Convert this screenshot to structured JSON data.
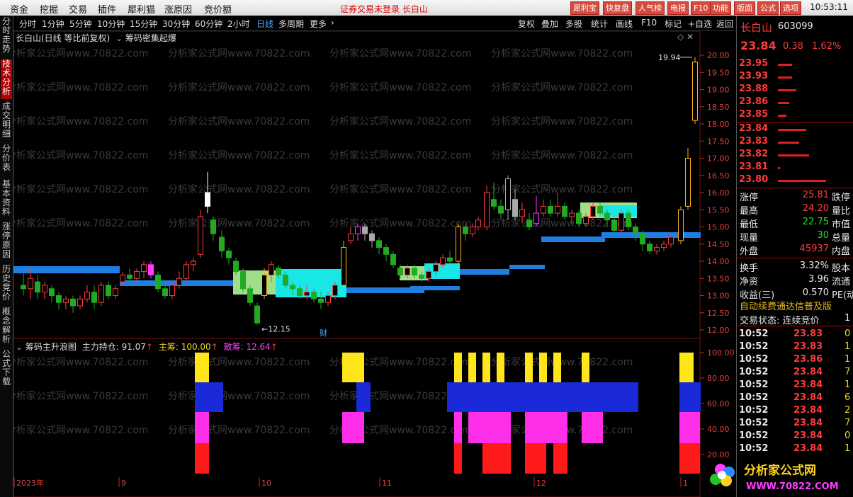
{
  "menu": [
    "资金",
    "挖掘",
    "交易",
    "插件",
    "犀利猫",
    "涨原因",
    "竞价额"
  ],
  "notice": "证券交易未登录  长白山",
  "top_buttons": [
    "犀利宝",
    "快复盘",
    "人气榜",
    "电报",
    "F10",
    "功能",
    "版面",
    "公式",
    "选项"
  ],
  "clock": "10:53:11",
  "left_tabs": [
    "分时走势",
    "技术分析",
    "成交明细",
    "分价表",
    "基本资料",
    "涨停原因",
    "历史竞价",
    "概念解析",
    "公式下载"
  ],
  "periods": [
    "分时",
    "1分钟",
    "5分钟",
    "10分钟",
    "15分钟",
    "30分钟",
    "60分钟",
    "2小时",
    "日线",
    "多周期",
    "更多"
  ],
  "active_period": "日线",
  "tools": [
    "复权",
    "叠加",
    "多股",
    "统计",
    "画线",
    "F10",
    "标记",
    "+自选",
    "返回"
  ],
  "chart_title": "长白山(日线 等比前复权)",
  "chart_indicator": "筹码密集起爆",
  "ind_title": "筹码主升浪图",
  "ind_vals": {
    "l1": "主力持仓: 91.07",
    "l2": "主筹: 100.00",
    "l3": "散筹: 12.64"
  },
  "annotations": {
    "high": "19.94",
    "low": "12.15",
    "cai": "财"
  },
  "axis_labels": [
    "20.00",
    "19.50",
    "19.00",
    "18.50",
    "18.00",
    "17.50",
    "17.00",
    "16.50",
    "16.00",
    "15.50",
    "15.00",
    "14.50",
    "14.00",
    "13.50",
    "13.00",
    "12.50",
    "12.00"
  ],
  "ind_axis": [
    "100.00",
    "80.00",
    "60.00",
    "40.00",
    "20.00"
  ],
  "x_labels": [
    "2023年",
    "9",
    "10",
    "11",
    "12",
    "1"
  ],
  "watermark": "分析家公式网www.70822.com",
  "stock": {
    "name": "长白山",
    "code": "603099",
    "price": "23.84",
    "change": "0.38",
    "pct": "1.62%"
  },
  "asks": [
    {
      "p": "23.95",
      "w": 20
    },
    {
      "p": "23.93",
      "w": 20
    },
    {
      "p": "23.88",
      "w": 26
    },
    {
      "p": "23.86",
      "w": 16
    },
    {
      "p": "23.85",
      "w": 12
    }
  ],
  "bids": [
    {
      "p": "23.84",
      "w": 40
    },
    {
      "p": "23.83",
      "w": 30
    },
    {
      "p": "23.82",
      "w": 44
    },
    {
      "p": "23.81",
      "w": 3
    },
    {
      "p": "23.80",
      "w": 68
    }
  ],
  "quote_rows": [
    {
      "l": "涨停",
      "v": "25.81",
      "vc": "red",
      "r": "跌停"
    },
    {
      "l": "最高",
      "v": "24.20",
      "vc": "red",
      "r": "量比"
    },
    {
      "l": "最低",
      "v": "22.75",
      "vc": "green",
      "r": "市值"
    },
    {
      "l": "现量",
      "v": "30",
      "vc": "green",
      "r": "总量"
    },
    {
      "l": "外盘",
      "v": "45937",
      "vc": "red",
      "r": "内盘"
    }
  ],
  "quote_rows2": [
    {
      "l": "换手",
      "v": "3.32%",
      "r": "股本"
    },
    {
      "l": "净资",
      "v": "3.96",
      "r": "流通"
    },
    {
      "l": "收益(三)",
      "v": "0.570",
      "r": "PE(动"
    }
  ],
  "scroll_text": "自动续费通达信普及版",
  "trade_status": "交易状态: 连续竞价",
  "trade_status_num": "1",
  "ticks": [
    {
      "t": "10:52",
      "p": "23.83",
      "c": "red",
      "v": "0"
    },
    {
      "t": "10:52",
      "p": "23.83",
      "c": "red",
      "v": "1"
    },
    {
      "t": "10:52",
      "p": "23.86",
      "c": "red",
      "v": "1"
    },
    {
      "t": "10:52",
      "p": "23.84",
      "c": "red",
      "v": "7"
    },
    {
      "t": "10:52",
      "p": "23.84",
      "c": "red",
      "v": "1"
    },
    {
      "t": "10:52",
      "p": "23.84",
      "c": "red",
      "v": "6"
    },
    {
      "t": "10:52",
      "p": "23.84",
      "c": "red",
      "v": "2"
    },
    {
      "t": "10:52",
      "p": "23.84",
      "c": "red",
      "v": "7"
    },
    {
      "t": "10:52",
      "p": "23.84",
      "c": "red",
      "v": "0"
    },
    {
      "t": "10:52",
      "p": "23.84",
      "c": "red",
      "v": "1"
    }
  ],
  "logo": {
    "cn": "分析家公式网",
    "url": "WWW.70822.COM"
  },
  "colors": {
    "up": "#ff3b3b",
    "down": "#22aa22",
    "bg": "#000000",
    "tab_active": "#b00000",
    "blue_band": "#1f7fe0"
  }
}
